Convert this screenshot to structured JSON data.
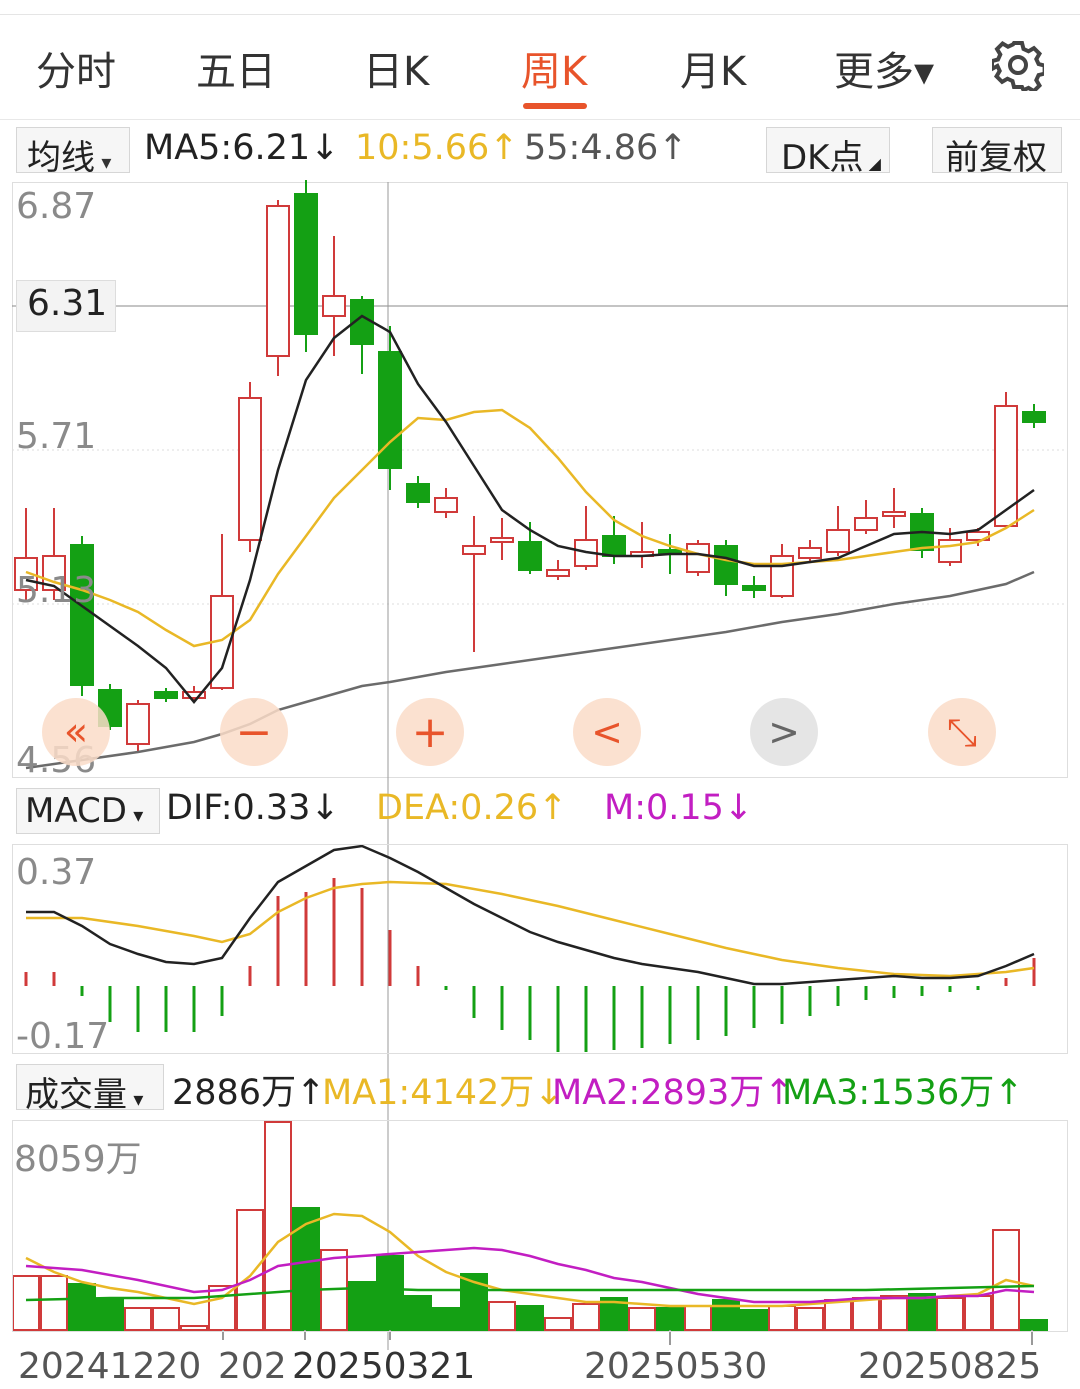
{
  "tabs": {
    "items": [
      "分时",
      "五日",
      "日K",
      "周K",
      "月K",
      "更多▾"
    ],
    "active": 3
  },
  "ma_row": {
    "selector": "均线",
    "ma5": "MA5:6.21↓",
    "ma10": "10:5.66↑",
    "ma55": "55:4.86↑",
    "dk": "DK点",
    "fq": "前复权"
  },
  "price_axis": {
    "top": "6.87",
    "current": "6.31",
    "mid": "5.71",
    "low": "5.13",
    "bottom": "4.56"
  },
  "macd_row": {
    "selector": "MACD",
    "dif": "DIF:0.33↓",
    "dea": "DEA:0.26↑",
    "m": "M:0.15↓"
  },
  "macd_axis": {
    "top": "0.37",
    "bottom": "-0.17"
  },
  "vol_row": {
    "selector": "成交量",
    "vol": "2886万↑",
    "ma1": "MA1:4142万↓",
    "ma2": "MA2:2893万↑",
    "ma3": "MA3:1536万↑"
  },
  "vol_axis": {
    "top": "8059万"
  },
  "dates": [
    "20241220",
    "202",
    "20250321",
    "20250530",
    "20250825"
  ],
  "nav": [
    "«",
    "−",
    "+",
    "<",
    ">",
    "⤡"
  ],
  "colors": {
    "up": "#d03a3a",
    "down": "#14a014",
    "ma5": "#222222",
    "ma10": "#e9b826",
    "ma55": "#6b6b6b",
    "macd_m": "#c21ec2",
    "accent": "#e8542b"
  }
}
